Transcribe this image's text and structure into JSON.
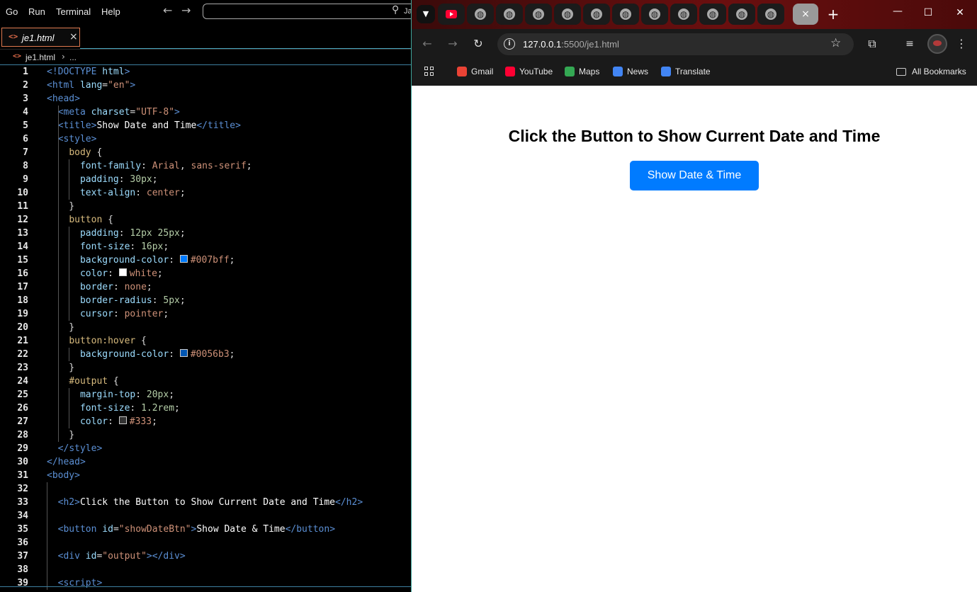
{
  "vscode": {
    "menu": [
      "Go",
      "Run",
      "Terminal",
      "Help"
    ],
    "command_center_partial": "Ja",
    "tab": {
      "label": "je1.html",
      "close": "×"
    },
    "breadcrumb": {
      "file": "je1.html",
      "more": "..."
    },
    "code_lines": [
      {
        "n": "1",
        "parts": [
          [
            "tag",
            "<!"
          ],
          [
            "tn",
            "DOCTYPE "
          ],
          [
            "attr",
            "html"
          ],
          [
            "tag",
            ">"
          ]
        ]
      },
      {
        "n": "2",
        "parts": [
          [
            "tag",
            "<"
          ],
          [
            "tn",
            "html "
          ],
          [
            "attr",
            "lang"
          ],
          [
            "pun",
            "="
          ],
          [
            "str",
            "\"en\""
          ],
          [
            "tag",
            ">"
          ]
        ]
      },
      {
        "n": "3",
        "parts": [
          [
            "tag",
            "<"
          ],
          [
            "tn",
            "head"
          ],
          [
            "tag",
            ">"
          ]
        ]
      },
      {
        "n": "4",
        "parts": [
          [
            "pun",
            "  "
          ],
          [
            "tag",
            "<"
          ],
          [
            "tn",
            "meta "
          ],
          [
            "attr",
            "charset"
          ],
          [
            "pun",
            "="
          ],
          [
            "str",
            "\"UTF-8\""
          ],
          [
            "tag",
            ">"
          ]
        ]
      },
      {
        "n": "5",
        "parts": [
          [
            "pun",
            "  "
          ],
          [
            "tag",
            "<"
          ],
          [
            "tn",
            "title"
          ],
          [
            "tag",
            ">"
          ],
          [
            "txt",
            "Show Date and Time"
          ],
          [
            "tag",
            "</"
          ],
          [
            "tn",
            "title"
          ],
          [
            "tag",
            ">"
          ]
        ]
      },
      {
        "n": "6",
        "parts": [
          [
            "pun",
            "  "
          ],
          [
            "tag",
            "<"
          ],
          [
            "tn",
            "style"
          ],
          [
            "tag",
            ">"
          ]
        ]
      },
      {
        "n": "7",
        "parts": [
          [
            "pun",
            "    "
          ],
          [
            "sel",
            "body"
          ],
          [
            "pun",
            " {"
          ]
        ]
      },
      {
        "n": "8",
        "parts": [
          [
            "pun",
            "      "
          ],
          [
            "prop",
            "font-family"
          ],
          [
            "pun",
            ": "
          ],
          [
            "val",
            "Arial"
          ],
          [
            "pun",
            ", "
          ],
          [
            "val",
            "sans-serif"
          ],
          [
            "pun",
            ";"
          ]
        ]
      },
      {
        "n": "9",
        "parts": [
          [
            "pun",
            "      "
          ],
          [
            "prop",
            "padding"
          ],
          [
            "pun",
            ": "
          ],
          [
            "num",
            "30px"
          ],
          [
            "pun",
            ";"
          ]
        ]
      },
      {
        "n": "10",
        "parts": [
          [
            "pun",
            "      "
          ],
          [
            "prop",
            "text-align"
          ],
          [
            "pun",
            ": "
          ],
          [
            "val",
            "center"
          ],
          [
            "pun",
            ";"
          ]
        ]
      },
      {
        "n": "11",
        "parts": [
          [
            "pun",
            "    }"
          ]
        ]
      },
      {
        "n": "12",
        "parts": [
          [
            "pun",
            "    "
          ],
          [
            "sel",
            "button"
          ],
          [
            "pun",
            " {"
          ]
        ]
      },
      {
        "n": "13",
        "parts": [
          [
            "pun",
            "      "
          ],
          [
            "prop",
            "padding"
          ],
          [
            "pun",
            ": "
          ],
          [
            "num",
            "12px 25px"
          ],
          [
            "pun",
            ";"
          ]
        ]
      },
      {
        "n": "14",
        "parts": [
          [
            "pun",
            "      "
          ],
          [
            "prop",
            "font-size"
          ],
          [
            "pun",
            ": "
          ],
          [
            "num",
            "16px"
          ],
          [
            "pun",
            ";"
          ]
        ]
      },
      {
        "n": "15",
        "parts": [
          [
            "pun",
            "      "
          ],
          [
            "prop",
            "background-color"
          ],
          [
            "pun",
            ": "
          ],
          [
            "sw",
            "#007bff"
          ],
          [
            "val",
            "#007bff"
          ],
          [
            "pun",
            ";"
          ]
        ]
      },
      {
        "n": "16",
        "parts": [
          [
            "pun",
            "      "
          ],
          [
            "prop",
            "color"
          ],
          [
            "pun",
            ": "
          ],
          [
            "sw",
            "#ffffff"
          ],
          [
            "val",
            "white"
          ],
          [
            "pun",
            ";"
          ]
        ]
      },
      {
        "n": "17",
        "parts": [
          [
            "pun",
            "      "
          ],
          [
            "prop",
            "border"
          ],
          [
            "pun",
            ": "
          ],
          [
            "val",
            "none"
          ],
          [
            "pun",
            ";"
          ]
        ]
      },
      {
        "n": "18",
        "parts": [
          [
            "pun",
            "      "
          ],
          [
            "prop",
            "border-radius"
          ],
          [
            "pun",
            ": "
          ],
          [
            "num",
            "5px"
          ],
          [
            "pun",
            ";"
          ]
        ]
      },
      {
        "n": "19",
        "parts": [
          [
            "pun",
            "      "
          ],
          [
            "prop",
            "cursor"
          ],
          [
            "pun",
            ": "
          ],
          [
            "val",
            "pointer"
          ],
          [
            "pun",
            ";"
          ]
        ]
      },
      {
        "n": "20",
        "parts": [
          [
            "pun",
            "    }"
          ]
        ]
      },
      {
        "n": "21",
        "parts": [
          [
            "pun",
            "    "
          ],
          [
            "sel",
            "button:hover"
          ],
          [
            "pun",
            " {"
          ]
        ]
      },
      {
        "n": "22",
        "parts": [
          [
            "pun",
            "      "
          ],
          [
            "prop",
            "background-color"
          ],
          [
            "pun",
            ": "
          ],
          [
            "sw",
            "#0056b3"
          ],
          [
            "val",
            "#0056b3"
          ],
          [
            "pun",
            ";"
          ]
        ]
      },
      {
        "n": "23",
        "parts": [
          [
            "pun",
            "    }"
          ]
        ]
      },
      {
        "n": "24",
        "parts": [
          [
            "pun",
            "    "
          ],
          [
            "sel",
            "#output"
          ],
          [
            "pun",
            " {"
          ]
        ]
      },
      {
        "n": "25",
        "parts": [
          [
            "pun",
            "      "
          ],
          [
            "prop",
            "margin-top"
          ],
          [
            "pun",
            ": "
          ],
          [
            "num",
            "20px"
          ],
          [
            "pun",
            ";"
          ]
        ]
      },
      {
        "n": "26",
        "parts": [
          [
            "pun",
            "      "
          ],
          [
            "prop",
            "font-size"
          ],
          [
            "pun",
            ": "
          ],
          [
            "num",
            "1.2rem"
          ],
          [
            "pun",
            ";"
          ]
        ]
      },
      {
        "n": "27",
        "parts": [
          [
            "pun",
            "      "
          ],
          [
            "prop",
            "color"
          ],
          [
            "pun",
            ": "
          ],
          [
            "sw",
            "#333333"
          ],
          [
            "val",
            "#333"
          ],
          [
            "pun",
            ";"
          ]
        ]
      },
      {
        "n": "28",
        "parts": [
          [
            "pun",
            "    }"
          ]
        ]
      },
      {
        "n": "29",
        "parts": [
          [
            "pun",
            "  "
          ],
          [
            "tag",
            "</"
          ],
          [
            "tn",
            "style"
          ],
          [
            "tag",
            ">"
          ]
        ]
      },
      {
        "n": "30",
        "parts": [
          [
            "tag",
            "</"
          ],
          [
            "tn",
            "head"
          ],
          [
            "tag",
            ">"
          ]
        ]
      },
      {
        "n": "31",
        "parts": [
          [
            "tag",
            "<"
          ],
          [
            "tn",
            "body"
          ],
          [
            "tag",
            ">"
          ]
        ]
      },
      {
        "n": "32",
        "parts": []
      },
      {
        "n": "33",
        "parts": [
          [
            "pun",
            "  "
          ],
          [
            "tag",
            "<"
          ],
          [
            "tn",
            "h2"
          ],
          [
            "tag",
            ">"
          ],
          [
            "txt",
            "Click the Button to Show Current Date and Time"
          ],
          [
            "tag",
            "</"
          ],
          [
            "tn",
            "h2"
          ],
          [
            "tag",
            ">"
          ]
        ]
      },
      {
        "n": "34",
        "parts": []
      },
      {
        "n": "35",
        "parts": [
          [
            "pun",
            "  "
          ],
          [
            "tag",
            "<"
          ],
          [
            "tn",
            "button "
          ],
          [
            "attr",
            "id"
          ],
          [
            "pun",
            "="
          ],
          [
            "str",
            "\"showDateBtn\""
          ],
          [
            "tag",
            ">"
          ],
          [
            "txt",
            "Show Date & Time"
          ],
          [
            "tag",
            "</"
          ],
          [
            "tn",
            "button"
          ],
          [
            "tag",
            ">"
          ]
        ]
      },
      {
        "n": "36",
        "parts": []
      },
      {
        "n": "37",
        "parts": [
          [
            "pun",
            "  "
          ],
          [
            "tag",
            "<"
          ],
          [
            "tn",
            "div "
          ],
          [
            "attr",
            "id"
          ],
          [
            "pun",
            "="
          ],
          [
            "str",
            "\"output\""
          ],
          [
            "tag",
            "></"
          ],
          [
            "tn",
            "div"
          ],
          [
            "tag",
            ">"
          ]
        ]
      },
      {
        "n": "38",
        "parts": []
      },
      {
        "n": "39",
        "parts": [
          [
            "pun",
            "  "
          ],
          [
            "tag",
            "<"
          ],
          [
            "tn",
            "script"
          ],
          [
            "tag",
            ">"
          ]
        ]
      }
    ]
  },
  "chrome": {
    "tab_icons": [
      "youtube-icon",
      "globe-icon",
      "globe-icon",
      "globe-icon",
      "globe-icon",
      "globe-icon",
      "globe-icon",
      "globe-icon",
      "globe-icon",
      "globe-icon",
      "globe-icon",
      "globe-icon"
    ],
    "active_tab_close": "×",
    "new_tab": "+",
    "url_host": "127.0.0.1",
    "url_path": ":5500/je1.html",
    "bookmarks": [
      {
        "label": "Gmail",
        "icon": "gmail-icon",
        "color": "#ea4335"
      },
      {
        "label": "YouTube",
        "icon": "youtube-icon",
        "color": "#ff0033"
      },
      {
        "label": "Maps",
        "icon": "maps-icon",
        "color": "#34a853"
      },
      {
        "label": "News",
        "icon": "news-icon",
        "color": "#4285f4"
      },
      {
        "label": "Translate",
        "icon": "translate-icon",
        "color": "#4285f4"
      }
    ],
    "all_bookmarks": "All Bookmarks"
  },
  "page": {
    "heading": "Click the Button to Show Current Date and Time",
    "button_label": "Show Date & Time",
    "button_color": "#007bff"
  }
}
